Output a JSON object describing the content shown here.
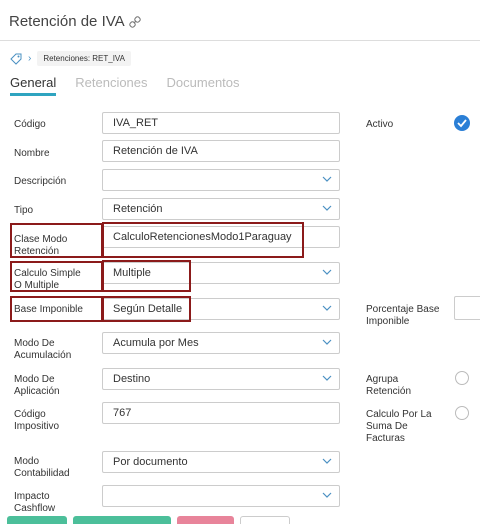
{
  "header": {
    "title": "Retención de IVA",
    "link_icon": "link-icon"
  },
  "breadcrumb": {
    "tag_icon": "tag-icon",
    "chevron_icon": "chevron-right-icon",
    "item": "Retenciones: RET_IVA"
  },
  "tabs": [
    {
      "label": "General",
      "active": true
    },
    {
      "label": "Retenciones",
      "active": false
    },
    {
      "label": "Documentos",
      "active": false
    }
  ],
  "fields": {
    "codigo": {
      "label": "Código",
      "value": "IVA_RET"
    },
    "nombre": {
      "label": "Nombre",
      "value": "Retención de IVA"
    },
    "descripcion": {
      "label": "Descripción",
      "value": ""
    },
    "tipo": {
      "label": "Tipo",
      "value": "Retención"
    },
    "clase_modo": {
      "label_line1": "Clase Modo",
      "label_line2": "Retención",
      "value": "CalculoRetencionesModo1Paraguay"
    },
    "calculo_simple": {
      "label_line1": "Calculo Simple",
      "label_line2": "O Multiple",
      "value": "Multiple"
    },
    "base_imponible": {
      "label": "Base Imponible",
      "value": "Según Detalle"
    },
    "modo_acumulacion": {
      "label_line1": "Modo De",
      "label_line2": "Acumulación",
      "value": "Acumula por Mes"
    },
    "modo_aplicacion": {
      "label_line1": "Modo De",
      "label_line2": "Aplicación",
      "value": "Destino"
    },
    "codigo_impositivo": {
      "label_line1": "Código",
      "label_line2": "Impositivo",
      "value": "767"
    },
    "modo_contabilidad": {
      "label_line1": "Modo",
      "label_line2": "Contabilidad",
      "value": "Por documento"
    },
    "impacto_cashflow": {
      "label_line1": "Impacto",
      "label_line2": "Cashflow",
      "value": ""
    }
  },
  "right_fields": {
    "activo": {
      "label": "Activo",
      "checked": true
    },
    "porcentaje_base": {
      "label_line1": "Porcentaje Base",
      "label_line2": "Imponible"
    },
    "agrupa_retencion": {
      "label_line1": "Agrupa",
      "label_line2": "Retención",
      "checked": false
    },
    "calculo_suma": {
      "label_line1": "Calculo Por La",
      "label_line2": "Suma De",
      "label_line3": "Facturas",
      "checked": false
    }
  },
  "colors": {
    "accent": "#2fa4c0",
    "highlight": "#8b1a1a",
    "check": "#2b7fd6"
  }
}
